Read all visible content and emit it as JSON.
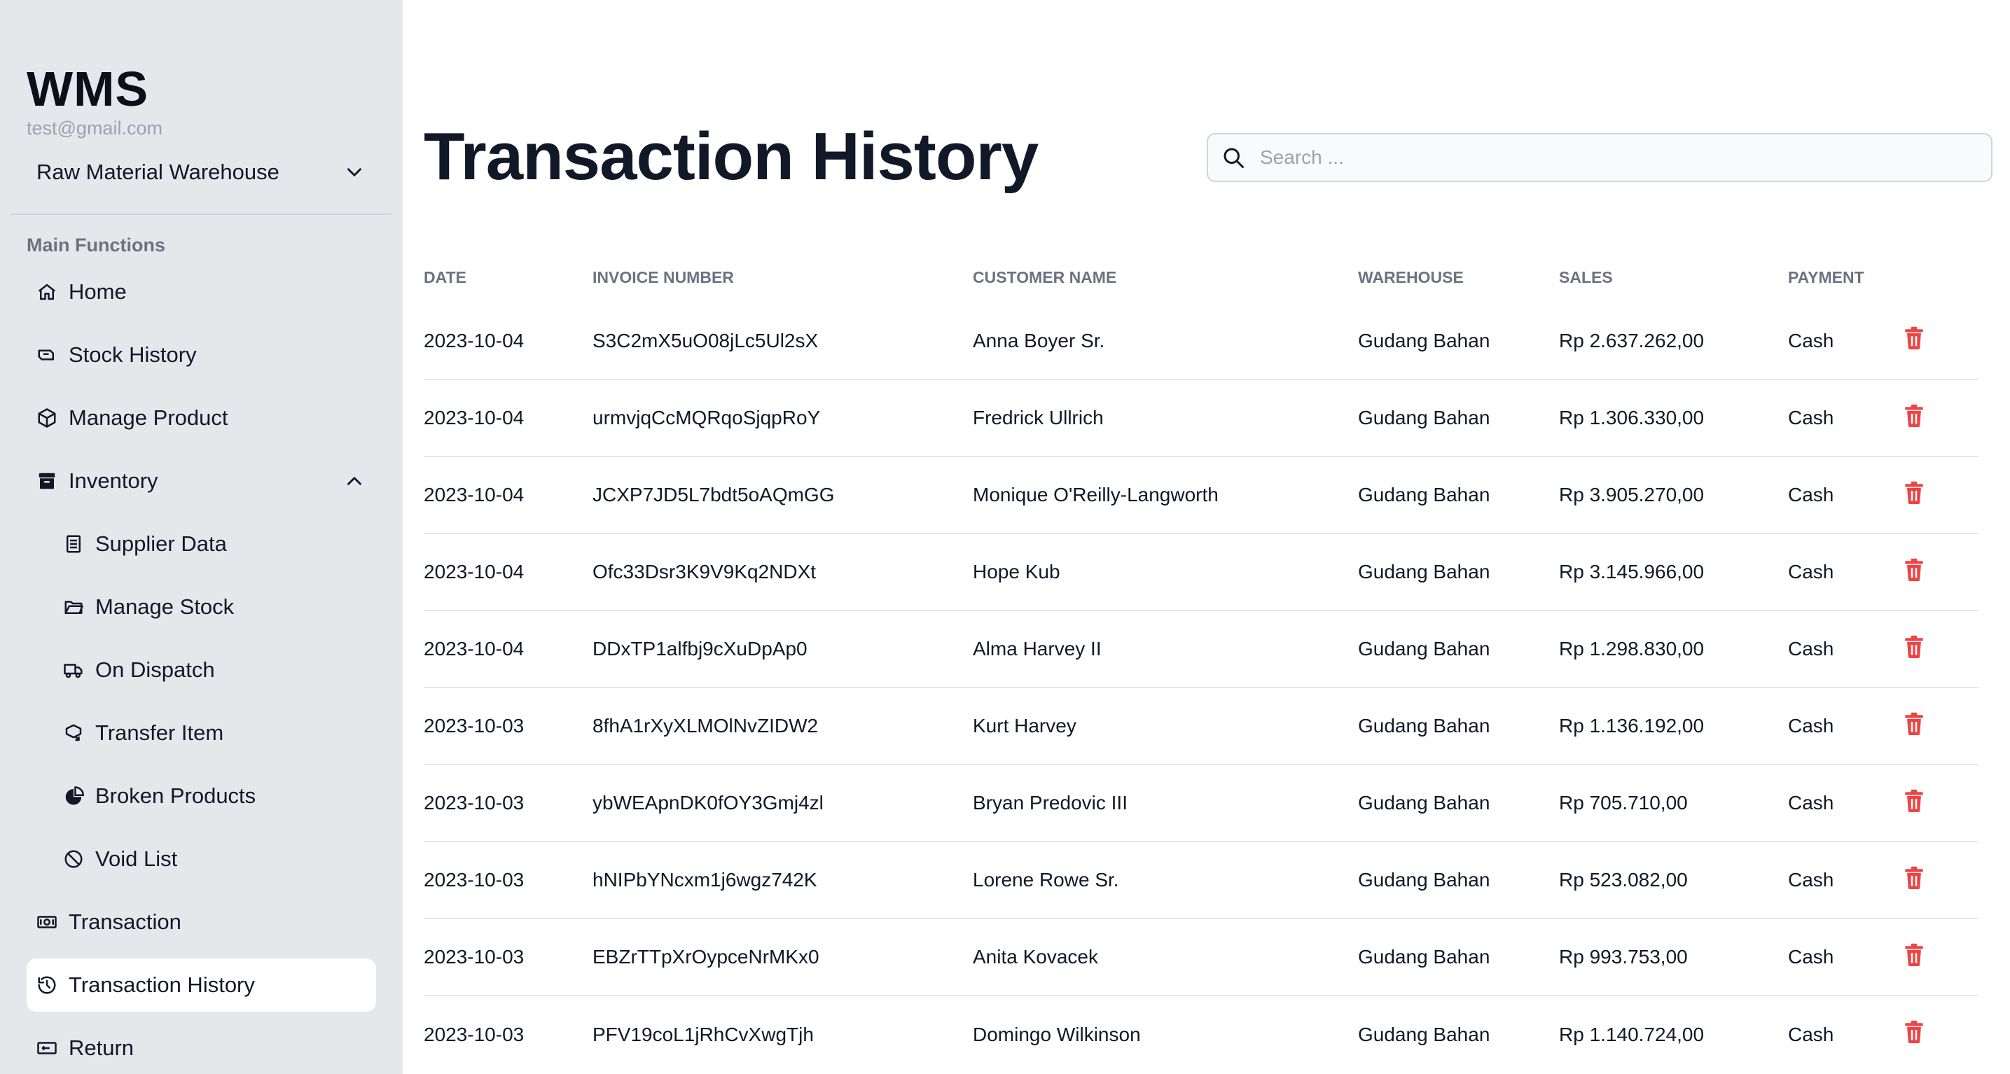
{
  "sidebar": {
    "brand": "WMS",
    "email": "test@gmail.com",
    "warehouse_selected": "Raw Material Warehouse",
    "section_label": "Main Functions",
    "items": [
      {
        "label": "Home",
        "icon": "home-icon"
      },
      {
        "label": "Stock History",
        "icon": "stock-history-icon"
      },
      {
        "label": "Manage Product",
        "icon": "cube-icon"
      },
      {
        "label": "Inventory",
        "icon": "archive-icon"
      },
      {
        "label": "Supplier Data",
        "icon": "document-icon"
      },
      {
        "label": "Manage Stock",
        "icon": "folder-icon"
      },
      {
        "label": "On Dispatch",
        "icon": "truck-icon"
      },
      {
        "label": "Transfer Item",
        "icon": "transfer-icon"
      },
      {
        "label": "Broken Products",
        "icon": "broken-icon"
      },
      {
        "label": "Void List",
        "icon": "ban-icon"
      },
      {
        "label": "Transaction",
        "icon": "cash-icon"
      },
      {
        "label": "Transaction History",
        "icon": "history-icon"
      },
      {
        "label": "Return",
        "icon": "return-icon"
      }
    ]
  },
  "main": {
    "title": "Transaction History",
    "search_placeholder": "Search ...",
    "columns": [
      "DATE",
      "INVOICE NUMBER",
      "CUSTOMER NAME",
      "WAREHOUSE",
      "SALES",
      "PAYMENT"
    ],
    "rows": [
      {
        "date": "2023-10-04",
        "invoice": "S3C2mX5uO08jLc5Ul2sX",
        "customer": "Anna Boyer Sr.",
        "warehouse": "Gudang Bahan",
        "sales": "Rp 2.637.262,00",
        "payment": "Cash"
      },
      {
        "date": "2023-10-04",
        "invoice": "urmvjqCcMQRqoSjqpRoY",
        "customer": "Fredrick Ullrich",
        "warehouse": "Gudang Bahan",
        "sales": "Rp 1.306.330,00",
        "payment": "Cash"
      },
      {
        "date": "2023-10-04",
        "invoice": "JCXP7JD5L7bdt5oAQmGG",
        "customer": "Monique O'Reilly-Langworth",
        "warehouse": "Gudang Bahan",
        "sales": "Rp 3.905.270,00",
        "payment": "Cash"
      },
      {
        "date": "2023-10-04",
        "invoice": "Ofc33Dsr3K9V9Kq2NDXt",
        "customer": "Hope Kub",
        "warehouse": "Gudang Bahan",
        "sales": "Rp 3.145.966,00",
        "payment": "Cash"
      },
      {
        "date": "2023-10-04",
        "invoice": "DDxTP1alfbj9cXuDpAp0",
        "customer": "Alma Harvey II",
        "warehouse": "Gudang Bahan",
        "sales": "Rp 1.298.830,00",
        "payment": "Cash"
      },
      {
        "date": "2023-10-03",
        "invoice": "8fhA1rXyXLMOlNvZIDW2",
        "customer": "Kurt Harvey",
        "warehouse": "Gudang Bahan",
        "sales": "Rp 1.136.192,00",
        "payment": "Cash"
      },
      {
        "date": "2023-10-03",
        "invoice": "ybWEApnDK0fOY3Gmj4zl",
        "customer": "Bryan Predovic III",
        "warehouse": "Gudang Bahan",
        "sales": "Rp 705.710,00",
        "payment": "Cash"
      },
      {
        "date": "2023-10-03",
        "invoice": "hNIPbYNcxm1j6wgz742K",
        "customer": "Lorene Rowe Sr.",
        "warehouse": "Gudang Bahan",
        "sales": "Rp 523.082,00",
        "payment": "Cash"
      },
      {
        "date": "2023-10-03",
        "invoice": "EBZrTTpXrOypceNrMKx0",
        "customer": "Anita Kovacek",
        "warehouse": "Gudang Bahan",
        "sales": "Rp 993.753,00",
        "payment": "Cash"
      },
      {
        "date": "2023-10-03",
        "invoice": "PFV19coL1jRhCvXwgTjh",
        "customer": "Domingo Wilkinson",
        "warehouse": "Gudang Bahan",
        "sales": "Rp 1.140.724,00",
        "payment": "Cash"
      }
    ]
  },
  "colors": {
    "sidebar_bg": "#e5e7eb",
    "delete_red": "#ef4444",
    "text_dark": "#111827",
    "muted": "#6b7280"
  }
}
